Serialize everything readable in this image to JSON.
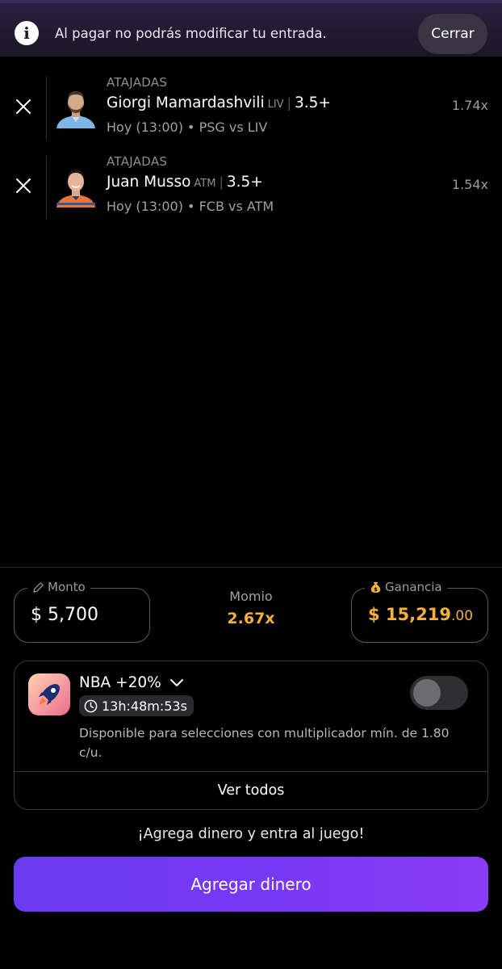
{
  "banner": {
    "message": "Al pagar no podrás modificar tu entrada.",
    "close_label": "Cerrar"
  },
  "picks": [
    {
      "stat": "ATAJADAS",
      "player": "Giorgi Mamardashvili",
      "team": "LIV",
      "line": "3.5+",
      "when": "Hoy (13:00) • PSG  vs LIV",
      "multiplier": "1.74x"
    },
    {
      "stat": "ATAJADAS",
      "player": "Juan Musso",
      "team": "ATM",
      "line": "3.5+",
      "when": "Hoy (13:00) • FCB  vs ATM",
      "multiplier": "1.54x"
    }
  ],
  "amount": {
    "label": "Monto",
    "value": "$ 5,700"
  },
  "momio": {
    "label": "Momio",
    "value": "2.67x"
  },
  "gain": {
    "label": "Ganancia",
    "value_main": "$ 15,219",
    "value_cents": ".00"
  },
  "promo": {
    "title": "NBA +20%",
    "timer": "13h:48m:53s",
    "description": "Disponible para selecciones con multiplicador mín. de 1.80 c/u.",
    "toggle_on": false,
    "see_all_label": "Ver todos"
  },
  "cta": {
    "text": "¡Agrega dinero y entra al juego!",
    "button_label": "Agregar dinero"
  },
  "colors": {
    "accent": "#7a38f5",
    "gold": "#f4b13a",
    "background": "#000000"
  }
}
